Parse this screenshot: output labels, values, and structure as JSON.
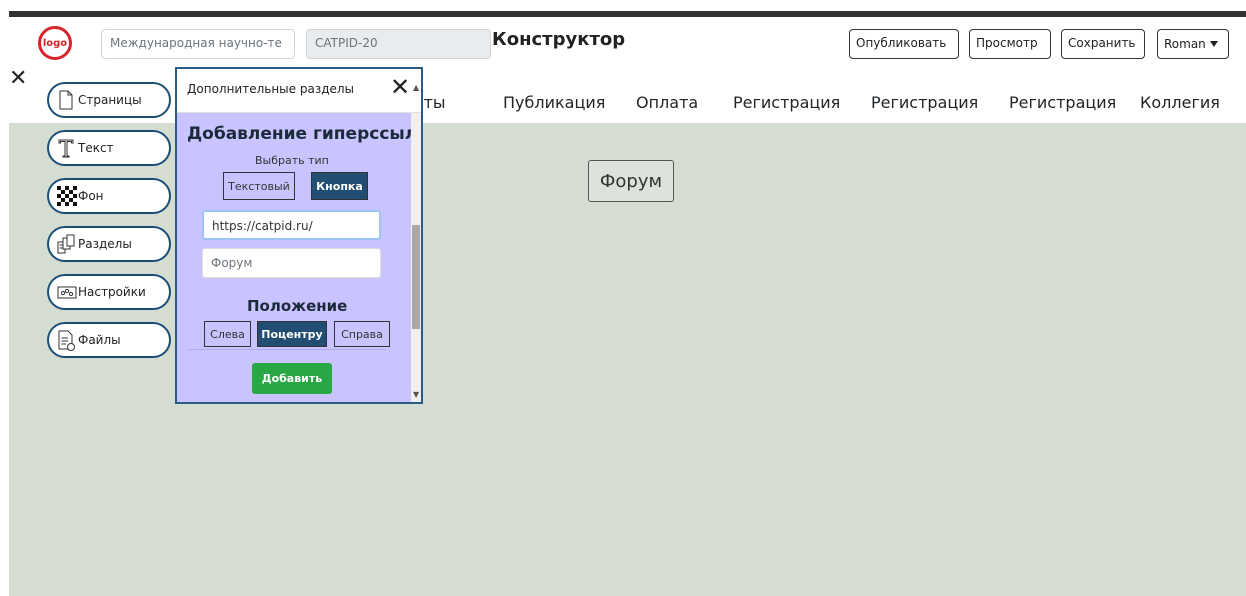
{
  "header": {
    "logo_text": "logo",
    "site_name_value": "Международная научно-те",
    "site_code_value": "CATPID-20",
    "title": "Конструктор",
    "publish_label": "Опубликовать",
    "preview_label": "Просмотр",
    "save_label": "Сохранить",
    "user_label": "Roman"
  },
  "nav": {
    "items": [
      "итеты",
      "Публикация",
      "Оплата",
      "Регистрация",
      "Регистрация",
      "Регистрация",
      "Коллегия"
    ]
  },
  "sidebar": {
    "items": [
      {
        "label": "Страницы",
        "icon": "page-icon"
      },
      {
        "label": "Текст",
        "icon": "text-icon"
      },
      {
        "label": "Фон",
        "icon": "checker-icon"
      },
      {
        "label": "Разделы",
        "icon": "sections-icon"
      },
      {
        "label": "Настройки",
        "icon": "settings-icon"
      },
      {
        "label": "Файлы",
        "icon": "file-icon"
      }
    ]
  },
  "canvas": {
    "forum_button_label": "Форум"
  },
  "modal": {
    "title": "Дополнительные разделы",
    "section_title": "Добавление гиперссылки",
    "choose_type_label": "Выбрать тип",
    "type_text_label": "Текстовый",
    "type_button_label": "Кнопка",
    "type_selected": "Кнопка",
    "url_value": "https://catpid.ru/",
    "anchor_value": "Форум",
    "position_title": "Положение",
    "pos_left_label": "Слева",
    "pos_center_label": "Поцентру",
    "pos_right_label": "Справа",
    "pos_selected": "Поцентру",
    "add_label": "Добавить"
  },
  "colors": {
    "modal_bg": "#c9c4ff",
    "selected_btn": "#234e74",
    "add_btn": "#28a745",
    "canvas_bg": "#d5dcd1",
    "logo_red": "#d9232d"
  }
}
